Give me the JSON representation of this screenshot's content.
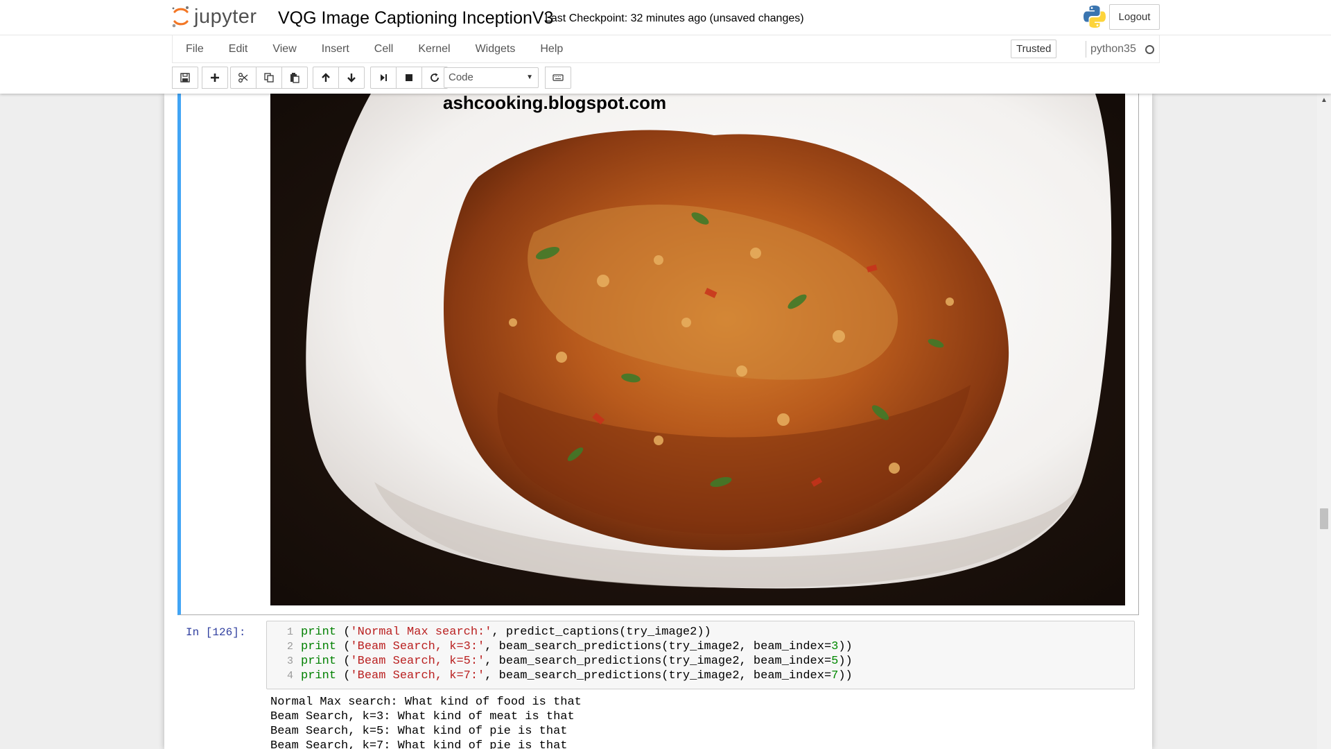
{
  "header": {
    "logo_text": "jupyter",
    "notebook_title": "VQG Image Captioning InceptionV3",
    "checkpoint": "Last Checkpoint: 32 minutes ago (unsaved changes)",
    "logout_label": "Logout"
  },
  "menubar": {
    "items": [
      "File",
      "Edit",
      "View",
      "Insert",
      "Cell",
      "Kernel",
      "Widgets",
      "Help"
    ],
    "trusted_label": "Trusted",
    "kernel_name": "python35"
  },
  "toolbar": {
    "cell_type": "Code",
    "buttons": [
      "save-icon",
      "plus-icon",
      "cut-icon",
      "copy-icon",
      "paste-icon",
      "arrow-up-icon",
      "arrow-down-icon",
      "run-icon",
      "stop-icon",
      "restart-icon",
      "keyboard-icon"
    ]
  },
  "image_cell": {
    "watermark": "ashcooking.blogspot.com"
  },
  "code_cell": {
    "prompt": "In [126]:",
    "lines": [
      {
        "num": "1",
        "code": "print ('Normal Max search:', predict_captions(try_image2))"
      },
      {
        "num": "2",
        "code": "print ('Beam Search, k=3:', beam_search_predictions(try_image2, beam_index=3))"
      },
      {
        "num": "3",
        "code": "print ('Beam Search, k=5:', beam_search_predictions(try_image2, beam_index=5))"
      },
      {
        "num": "4",
        "code": "print ('Beam Search, k=7:', beam_search_predictions(try_image2, beam_index=7))"
      }
    ],
    "output": [
      "Normal Max search: What kind of food is that",
      "Beam Search, k=3: What kind of meat is that",
      "Beam Search, k=5: What kind of pie is that",
      "Beam Search, k=7: What kind of pie is that"
    ]
  },
  "colors": {
    "selected_cell_border": "#42a5f5",
    "prompt": "#303f9f",
    "keyword": "#008000",
    "string": "#ba2121"
  }
}
